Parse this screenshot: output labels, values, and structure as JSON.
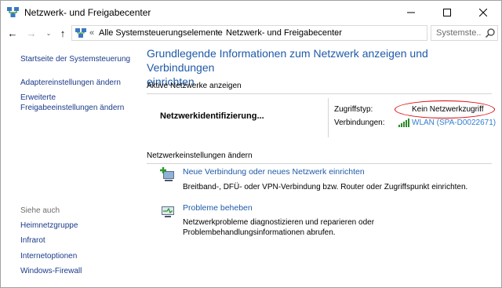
{
  "window": {
    "title": "Netzwerk- und Freigabecenter",
    "controls": {
      "minimize": "—",
      "maximize": "☐",
      "close": "✕"
    }
  },
  "nav": {
    "back": "←",
    "forward": "→",
    "recent": "⌄",
    "up": "↑",
    "overflow": "«",
    "breadcrumb": [
      "Alle Systemsteuerungselemente",
      "Netzwerk- und Freigabecenter"
    ],
    "separator": "›",
    "dropdown": "⌄",
    "refresh": "↻",
    "search_placeholder": "Systemste..."
  },
  "sidebar": {
    "home": "Startseite der Systemsteuerung",
    "items": [
      "Adaptereinstellungen ändern",
      "Erweiterte",
      "Freigabeeinstellungen ändern"
    ],
    "see_also_heading": "Siehe auch",
    "see_also": [
      "Heimnetzgruppe",
      "Infrarot",
      "Internetoptionen",
      "Windows-Firewall"
    ]
  },
  "main": {
    "title_line1": "Grundlegende Informationen zum Netzwerk anzeigen und Verbindungen",
    "title_line2": "einrichten",
    "active_section": "Aktive Netzwerke anzeigen",
    "network_name": "Netzwerkidentifizierung...",
    "access_label": "Zugriffstyp:",
    "access_value": "Kein Netzwerkzugriff",
    "connections_label": "Verbindungen:",
    "connection_value": "WLAN (SPA-D0022671)",
    "settings_section": "Netzwerkeinstellungen ändern",
    "tasks": [
      {
        "link": "Neue Verbindung oder neues Netzwerk einrichten",
        "desc1": "Breitband-, DFÜ- oder VPN-Verbindung bzw. Router oder Zugriffspunkt einrichten.",
        "desc2": ""
      },
      {
        "link": "Probleme beheben",
        "desc1": "Netzwerkprobleme diagnostizieren und reparieren oder",
        "desc2": "Problembehandlungsinformationen abrufen."
      }
    ]
  },
  "colors": {
    "link": "#1e5aa8",
    "wlan_link": "#2f7fd1",
    "highlight_oval": "#e00000",
    "muted": "#6d6d6d"
  }
}
